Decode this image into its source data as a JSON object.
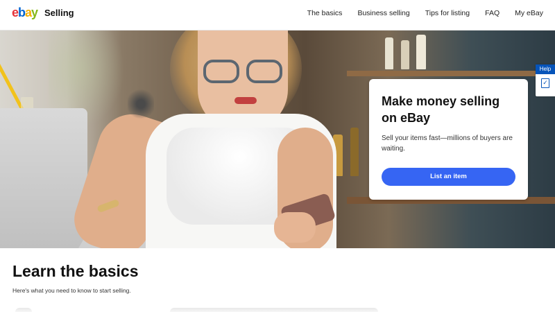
{
  "header": {
    "logo_text": "ebay",
    "title": "Selling",
    "nav": [
      "The basics",
      "Business selling",
      "Tips for listing",
      "FAQ",
      "My eBay"
    ]
  },
  "hero": {
    "card_title": "Make money selling on eBay",
    "card_subtitle": "Sell your items fast—millions of buyers are waiting.",
    "cta_label": "List an item"
  },
  "help": {
    "label": "Help",
    "icon": "feedback-icon"
  },
  "learn": {
    "title": "Learn the basics",
    "subtitle": "Here's what you need to know to start selling."
  },
  "colors": {
    "cta": "#3665f3",
    "help": "#0654ba",
    "logo_e": "#e53238",
    "logo_b": "#0064d2",
    "logo_a": "#f5af02",
    "logo_y": "#86b817"
  }
}
